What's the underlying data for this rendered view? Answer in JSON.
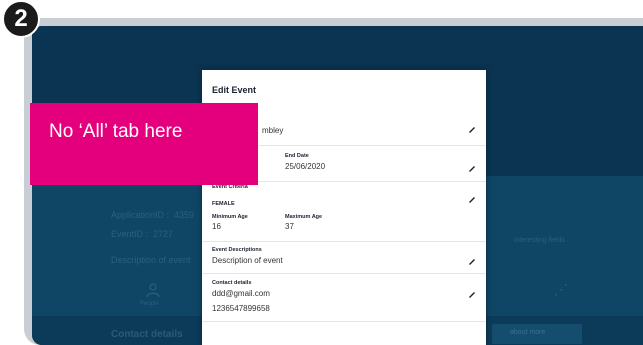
{
  "step_number": "2",
  "callout": {
    "text": "No ‘All’ tab here"
  },
  "background": {
    "application_id_label": "ApplicationID :",
    "application_id_value": "4359",
    "event_id_label": "EventID :",
    "event_id_value": "2727",
    "description": "Description of event",
    "people_label": "People",
    "contact_details_heading": "Contact details",
    "right_label": "Interesting fields",
    "right_bottom_label": "about more"
  },
  "modal": {
    "title": "Edit Event",
    "venue_value": "mbley",
    "end_date_label": "End Date",
    "end_date_value": "25/06/2020",
    "event_criteria_label": "Event Criteria",
    "criteria_value": "FEMALE",
    "min_age_label": "Minimum Age",
    "min_age_value": "16",
    "max_age_label": "Maximum Age",
    "max_age_value": "37",
    "descriptions_label": "Event Descriptions",
    "description_value": "Description of event",
    "contact_label": "Contact details",
    "email_value": "ddd@gmail.com",
    "phone_value": "1236547899658"
  },
  "colors": {
    "callout": "#e4007c",
    "app_background": "#0d3e5e",
    "badge": "#1b1b1b"
  }
}
